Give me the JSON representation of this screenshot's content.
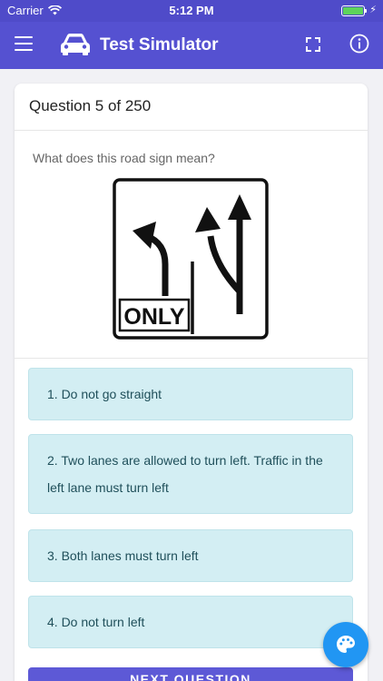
{
  "status_bar": {
    "carrier": "Carrier",
    "time": "5:12 PM"
  },
  "nav": {
    "title": "Test Simulator"
  },
  "question": {
    "header": "Question 5 of 250",
    "prompt": "What does this road sign mean?",
    "sign_text": "ONLY",
    "options": [
      "1. Do not go straight",
      "2. Two lanes are allowed to turn left. Traffic in the left lane must turn left",
      "3. Both lanes must turn left",
      "4. Do not turn left"
    ]
  },
  "next_button": {
    "label": "NEXT QUESTION"
  },
  "colors": {
    "primary": "#5551d1",
    "status_bar": "#4f4bc9",
    "option_bg": "#d3eef3",
    "fab": "#2196f3"
  },
  "icons": [
    "menu-icon",
    "car-icon",
    "expand-icon",
    "info-icon",
    "palette-icon",
    "wifi-icon",
    "battery-icon"
  ]
}
